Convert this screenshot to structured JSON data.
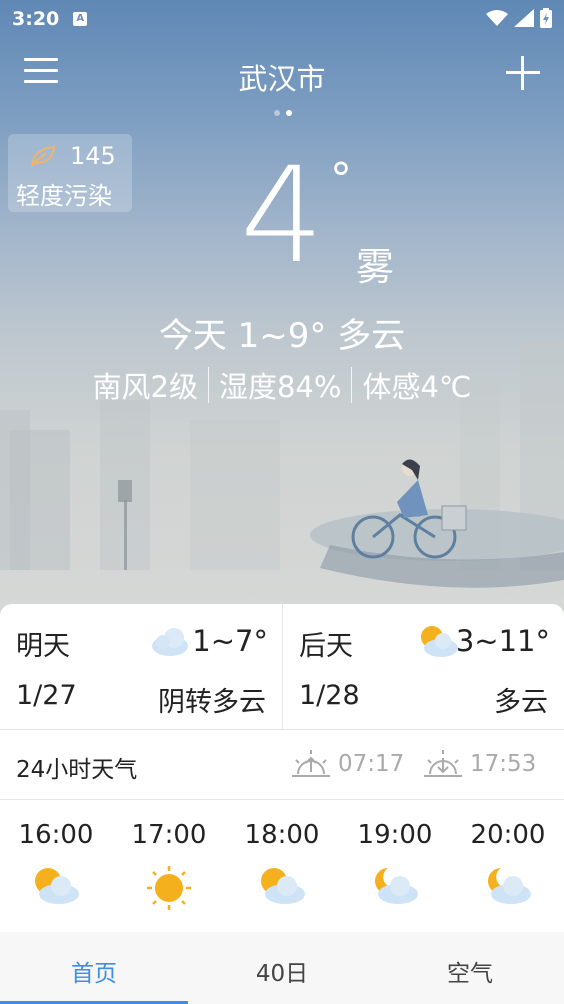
{
  "status": {
    "time": "3:20",
    "app_badge": "A"
  },
  "header": {
    "city": "武汉市"
  },
  "aqi": {
    "value": "145",
    "label": "轻度污染"
  },
  "current": {
    "temp": "4",
    "deg": "°",
    "condition": "雾",
    "today": "今天 1~9° 多云",
    "wind": "南风2级",
    "humidity": "湿度84%",
    "feels": "体感4℃"
  },
  "forecast": [
    {
      "day": "明天",
      "date": "1/27",
      "range": "1~7°",
      "desc": "阴转多云",
      "icon": "cloudy-icon"
    },
    {
      "day": "后天",
      "date": "1/28",
      "range": "3~11°",
      "desc": "多云",
      "icon": "partly-cloudy-icon"
    }
  ],
  "hourly_header": {
    "title": "24小时天气",
    "sunrise": "07:17",
    "sunset": "17:53"
  },
  "hourly": [
    {
      "time": "16:00",
      "icon": "partly-cloudy-icon"
    },
    {
      "time": "17:00",
      "icon": "sunny-icon"
    },
    {
      "time": "18:00",
      "icon": "partly-cloudy-icon"
    },
    {
      "time": "19:00",
      "icon": "moon-cloudy-icon"
    },
    {
      "time": "20:00",
      "icon": "moon-cloudy-icon"
    }
  ],
  "tabs": [
    {
      "label": "首页",
      "active": true
    },
    {
      "label": "40日",
      "active": false
    },
    {
      "label": "空气",
      "active": false
    }
  ],
  "colors": {
    "accent": "#3c8ee8",
    "sky_top": "#5f88b5",
    "sun": "#f5b01d"
  }
}
